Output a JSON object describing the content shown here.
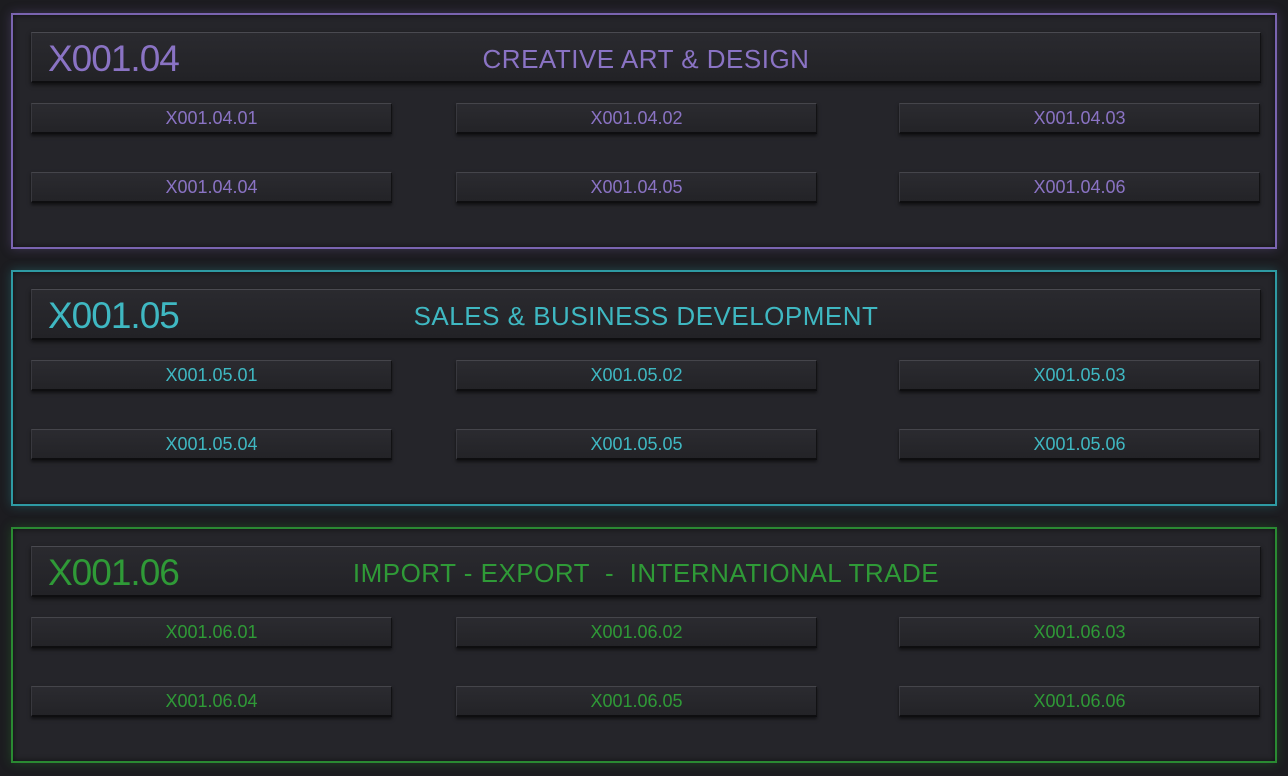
{
  "sections": [
    {
      "code": "X001.04",
      "title": "CREATIVE ART & DESIGN",
      "accent": "#8a73c4",
      "items": [
        "X001.04.01",
        "X001.04.02",
        "X001.04.03",
        "X001.04.04",
        "X001.04.05",
        "X001.04.06"
      ]
    },
    {
      "code": "X001.05",
      "title": "SALES & BUSINESS DEVELOPMENT",
      "accent": "#3fb8c2",
      "items": [
        "X001.05.01",
        "X001.05.02",
        "X001.05.03",
        "X001.05.04",
        "X001.05.05",
        "X001.05.06"
      ]
    },
    {
      "code": "X001.06",
      "title": "IMPORT - EXPORT  -  INTERNATIONAL TRADE",
      "accent": "#2f9a37",
      "items": [
        "X001.06.01",
        "X001.06.02",
        "X001.06.03",
        "X001.06.04",
        "X001.06.05",
        "X001.06.06"
      ]
    }
  ]
}
